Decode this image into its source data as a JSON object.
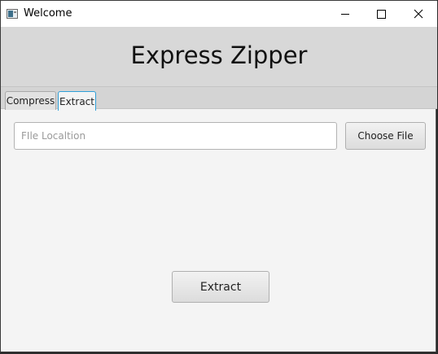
{
  "window": {
    "title": "Welcome"
  },
  "header": {
    "app_title": "Express Zipper"
  },
  "tabs": [
    {
      "label": "Compress",
      "selected": false
    },
    {
      "label": "Extract",
      "selected": true
    }
  ],
  "extract": {
    "file_location": {
      "placeholder": "FIle Localtion",
      "value": ""
    },
    "choose_file_label": "Choose File",
    "extract_label": "Extract"
  },
  "colors": {
    "header_bg": "#d8d8d8",
    "content_bg": "#f4f4f4",
    "tab_focus": "#2f9fd8"
  }
}
